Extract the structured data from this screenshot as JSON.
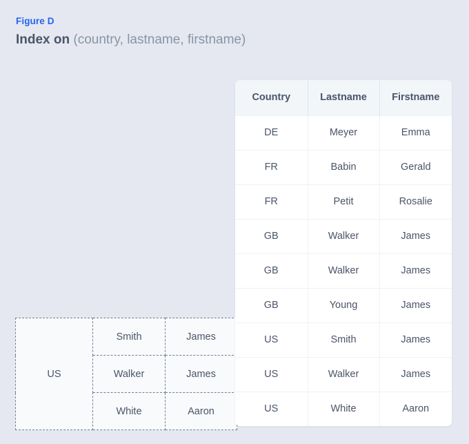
{
  "figure": {
    "label": "Figure D",
    "title_strong": "Index on",
    "title_light": "(country, lastname, firstname)",
    "accent_color": "#2563f0",
    "text_color": "#4a5568",
    "background_color": "#e5e8f0"
  },
  "index_table": {
    "columns": [
      "Country",
      "Lastname",
      "Firstname"
    ],
    "rows": [
      [
        "DE",
        "Meyer",
        "Emma"
      ],
      [
        "FR",
        "Babin",
        "Gerald"
      ],
      [
        "FR",
        "Petit",
        "Rosalie"
      ],
      [
        "GB",
        "Walker",
        "James"
      ],
      [
        "GB",
        "Walker",
        "James"
      ],
      [
        "GB",
        "Young",
        "James"
      ],
      [
        "US",
        "Smith",
        "James"
      ],
      [
        "US",
        "Walker",
        "James"
      ],
      [
        "US",
        "White",
        "Aaron"
      ]
    ]
  },
  "grouped_table": {
    "merged_country": "US",
    "rows": [
      [
        "Smith",
        "James"
      ],
      [
        "Walker",
        "James"
      ],
      [
        "White",
        "Aaron"
      ]
    ]
  }
}
